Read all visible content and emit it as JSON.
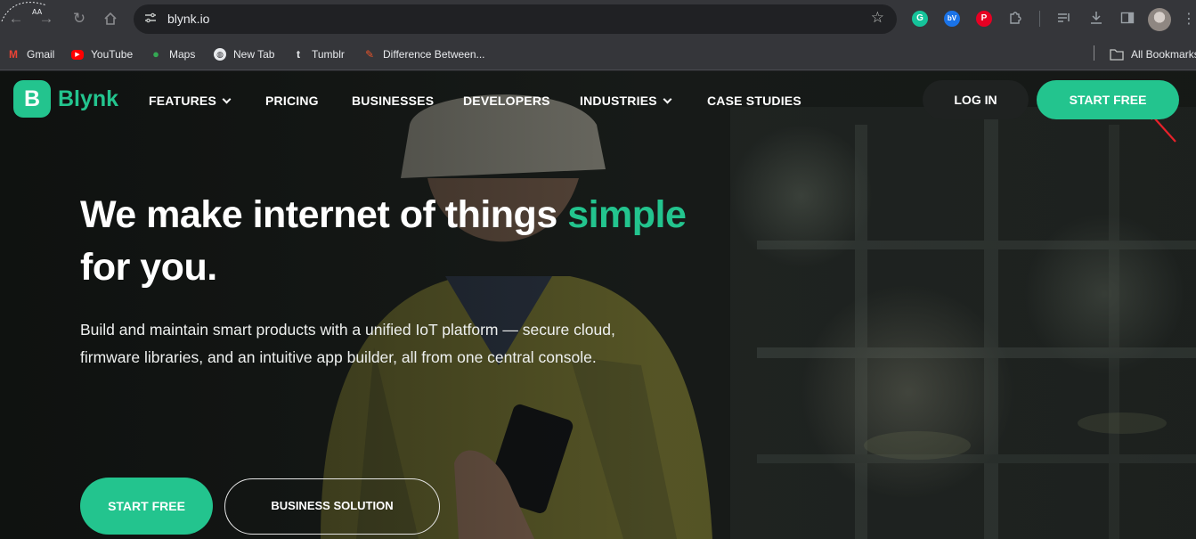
{
  "browser": {
    "url": "blynk.io",
    "icons": {
      "back": "arrow-left-icon",
      "forward": "arrow-right-icon",
      "reload": "reload-icon",
      "home": "home-icon",
      "site_info": "tune-icon",
      "bookmark": "star-icon",
      "extensions": [
        "grammarly-icon",
        "translate-extension-icon",
        "pinterest-icon",
        "puzzle-icon"
      ],
      "reading_list": "reading-list-icon",
      "downloads": "download-icon",
      "side_panel": "side-panel-icon",
      "menu": "kebab-menu-icon"
    },
    "bookmarks": [
      {
        "label": "Gmail",
        "icon": "gmail-icon",
        "color": "#ea4335"
      },
      {
        "label": "YouTube",
        "icon": "youtube-icon",
        "color": "#ff0000"
      },
      {
        "label": "Maps",
        "icon": "maps-icon",
        "color": "#34a853"
      },
      {
        "label": "New Tab",
        "icon": "globe-icon",
        "color": "#e8eaed"
      },
      {
        "label": "Tumblr",
        "icon": "tumblr-icon",
        "color": "#36465d"
      },
      {
        "label": "Difference Between...",
        "icon": "page-favicon-icon",
        "color": "#e8542a"
      },
      {
        "label": "All Bookmarks",
        "icon": "folder-icon",
        "color": "#9aa0a6"
      }
    ]
  },
  "site": {
    "brand": {
      "mark": "B",
      "name": "Blynk"
    },
    "nav": [
      {
        "label": "FEATURES",
        "dropdown": true
      },
      {
        "label": "PRICING",
        "dropdown": false
      },
      {
        "label": "BUSINESSES",
        "dropdown": false
      },
      {
        "label": "DEVELOPERS",
        "dropdown": false
      },
      {
        "label": "INDUSTRIES",
        "dropdown": true
      },
      {
        "label": "CASE STUDIES",
        "dropdown": false
      }
    ],
    "login_label": "LOG IN",
    "start_free_label": "START FREE",
    "hero": {
      "headline_part1": "We make internet of things",
      "headline_accent": "simple",
      "headline_part2": "for you.",
      "description": "Build and maintain smart products with a unified IoT platform — secure cloud, firmware libraries, and an intuitive app builder, all from one central console.",
      "primary_cta": "START FREE",
      "secondary_cta": "BUSINESS SOLUTION"
    },
    "colors": {
      "accent": "#23c48e",
      "annotation_arrow": "#e8212a"
    }
  }
}
